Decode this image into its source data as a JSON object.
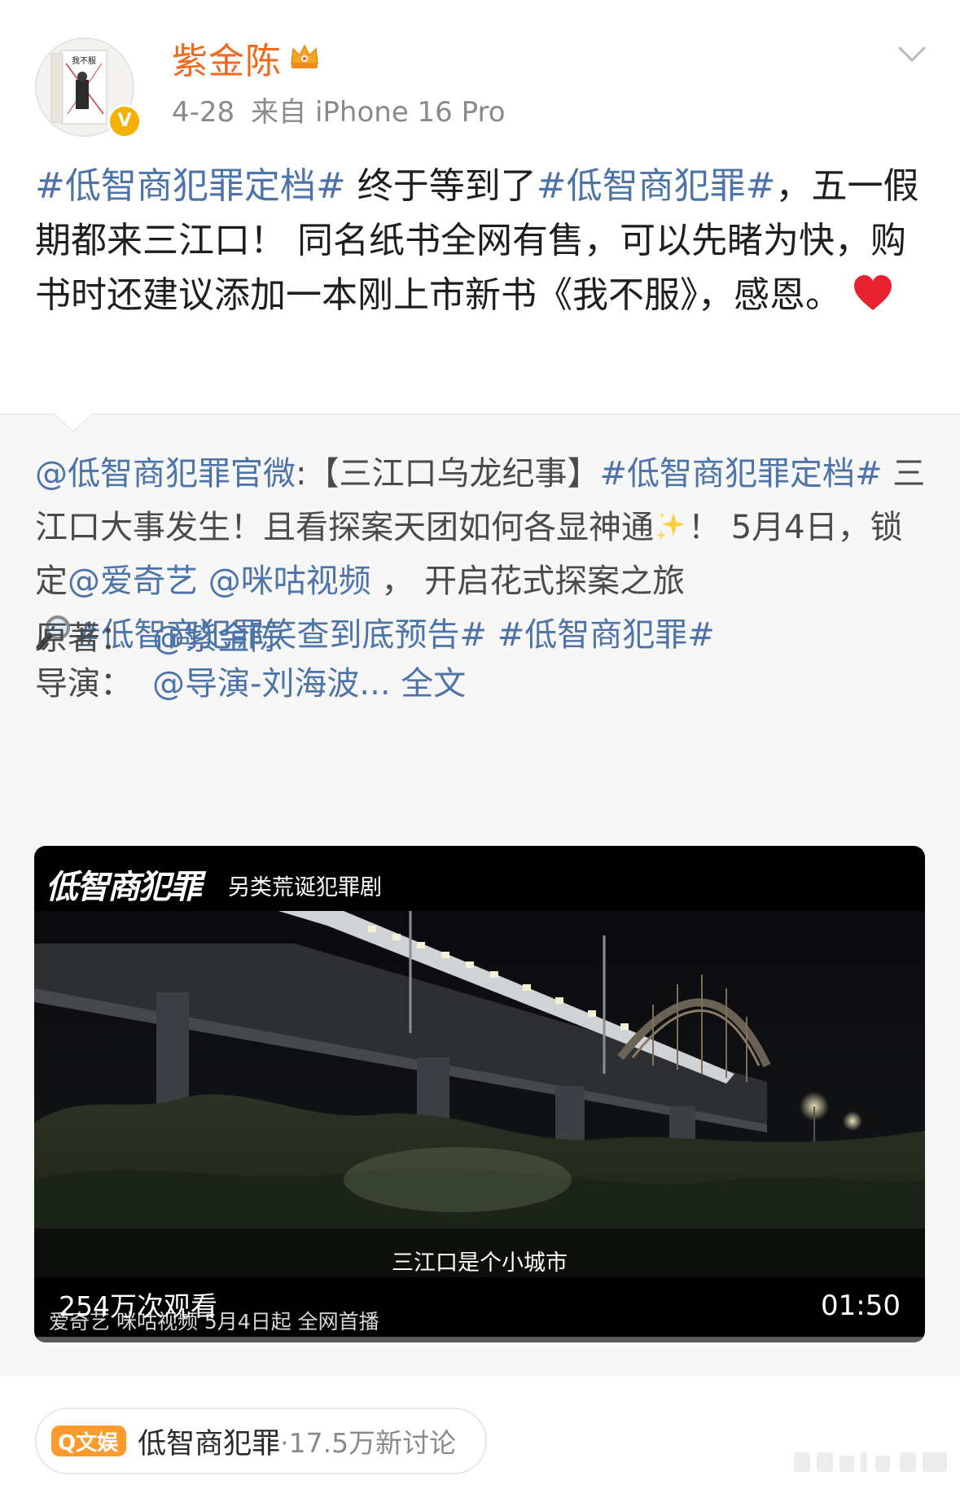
{
  "header": {
    "username": "紫金陈",
    "date": "4-28",
    "source": "来自 iPhone 16 Pro",
    "verified_mark": "V",
    "avatar_book_title": "我不服"
  },
  "post": {
    "tag1": "#低智商犯罪定档#",
    "text1": " 终于等到了",
    "tag2": "#低智商犯罪#",
    "text2": "，五一假期都来三江口！ 同名纸书全网有售，可以先睹为快，购书时还建议添加一本刚上市新书《我不服》，感恩。"
  },
  "repost": {
    "author": "@低智商犯罪官微",
    "colon": ":【三江口乌龙纪事】",
    "tag1": "#低智商犯罪定档#",
    "text1": " 三江口大事发生！且看探案天团如何各显神通",
    "text2": "！ 5月4日，锁定",
    "mention1": "@爱奇艺",
    "mention2": "@咪咕视频",
    "text3": " ， 开启花式探案之旅",
    "tag2": "#低智商犯罪笑查到底预告#",
    "tag3": "#低智商犯罪#",
    "credit1_label": "原著：",
    "credit1_value": "@紫金陈",
    "credit2_label": "导演：",
    "credit2_value": "@导演-刘海波...",
    "full_text_link": "全文"
  },
  "video": {
    "brand_logo": "低智商犯罪",
    "brand_subtitle": "另类荒诞犯罪剧",
    "subtitle": "三江口是个小城市",
    "views": "254万次观看",
    "credit_line": "爱奇艺 咪咕视频 5月4日起 全网首播",
    "duration": "01:50",
    "progress": 0
  },
  "topic": {
    "badge": "Q文娱",
    "name": "低智商犯罪",
    "count": "·17.5万新讨论"
  },
  "colors": {
    "username": "#f06a1d",
    "link": "#4d74a8",
    "badge": "#ff9a2e"
  }
}
